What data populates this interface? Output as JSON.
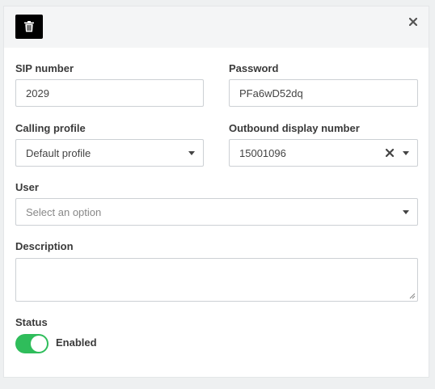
{
  "form": {
    "sip_number": {
      "label": "SIP number",
      "value": "2029"
    },
    "password": {
      "label": "Password",
      "value": "PFa6wD52dq"
    },
    "calling_profile": {
      "label": "Calling profile",
      "value": "Default profile"
    },
    "outbound_display_number": {
      "label": "Outbound display number",
      "value": "15001096"
    },
    "user": {
      "label": "User",
      "placeholder": "Select an option"
    },
    "description": {
      "label": "Description",
      "value": ""
    },
    "status": {
      "label": "Status",
      "toggle_text": "Enabled",
      "enabled": true
    }
  },
  "icons": {
    "delete": "trash-icon",
    "close": "close-icon",
    "dropdown": "caret-down-icon",
    "clear": "clear-icon"
  },
  "colors": {
    "toggle_on": "#2fbd5b",
    "delete_button": "#000000",
    "header_bg": "#f4f5f6"
  }
}
